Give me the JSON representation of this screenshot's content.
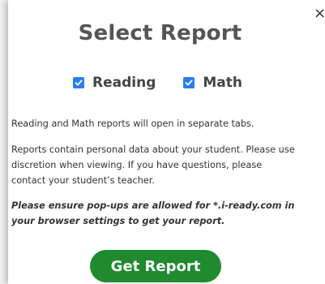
{
  "dialog": {
    "title": "Select Report",
    "close_label": "×",
    "subjects": [
      {
        "label": "Reading",
        "checked": true
      },
      {
        "label": "Math",
        "checked": true
      }
    ],
    "paragraphs": {
      "tabs_note": "Reading and Math reports will open in separate tabs.",
      "privacy_note": "Reports contain personal data about your student. Please use discretion when viewing. If you have questions, please contact your student’s teacher.",
      "popup_note": "Please ensure pop-ups are allowed for *.i-ready.com in your browser settings to get your report."
    },
    "button_label": "Get Report"
  },
  "colors": {
    "accent_checkbox": "#2a7ee8",
    "button_green": "#1f8a2e",
    "title_gray": "#555555"
  }
}
